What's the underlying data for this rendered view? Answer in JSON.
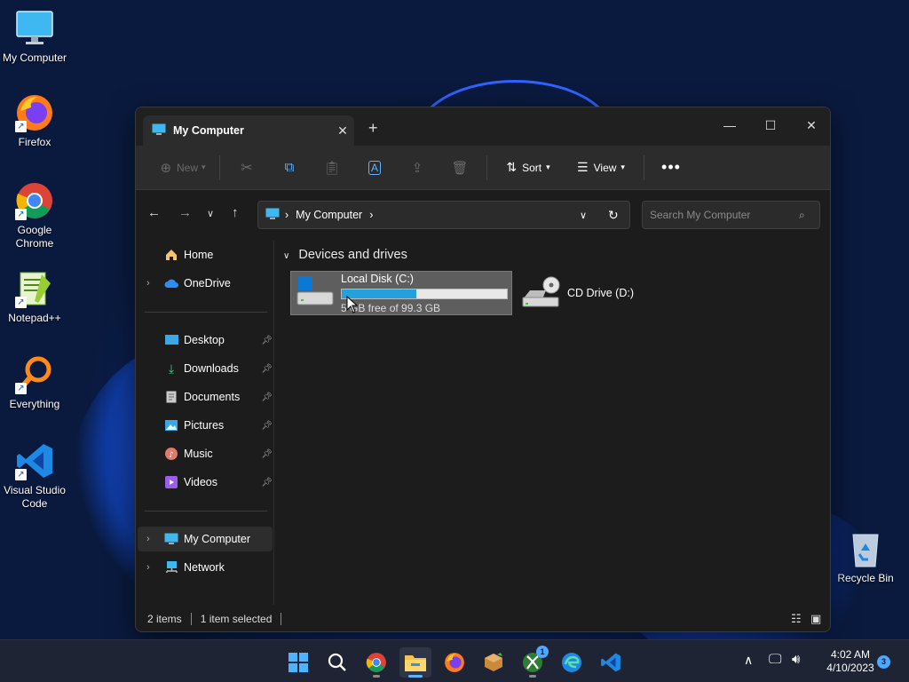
{
  "desktop": {
    "icons": [
      {
        "label": "My Computer"
      },
      {
        "label": "Firefox"
      },
      {
        "label": "Google Chrome"
      },
      {
        "label": "Notepad++"
      },
      {
        "label": "Everything"
      },
      {
        "label": "Visual Studio Code"
      },
      {
        "label": "Recycle Bin"
      }
    ]
  },
  "window": {
    "tab_title": "My Computer",
    "toolbar": {
      "new_label": "New",
      "sort_label": "Sort",
      "view_label": "View"
    },
    "address": {
      "segment": "My Computer"
    },
    "search": {
      "placeholder": "Search My Computer"
    },
    "sidebar": {
      "items": [
        {
          "label": "Home"
        },
        {
          "label": "OneDrive"
        },
        {
          "label": "Desktop"
        },
        {
          "label": "Downloads"
        },
        {
          "label": "Documents"
        },
        {
          "label": "Pictures"
        },
        {
          "label": "Music"
        },
        {
          "label": "Videos"
        },
        {
          "label": "My Computer"
        },
        {
          "label": "Network"
        }
      ]
    },
    "content": {
      "group_label": "Devices and drives",
      "drives": [
        {
          "name": "Local Disk (C:)",
          "free_text": "5 GB free of 99.3 GB",
          "used_fraction": 0.45
        },
        {
          "name": "CD Drive (D:)"
        }
      ]
    },
    "status": {
      "items_count": "2 items",
      "selected": "1 item selected"
    }
  },
  "taskbar": {
    "xbox_badge": "1",
    "time": "4:02 AM",
    "date": "4/10/2023",
    "notification_count": "3"
  },
  "colors": {
    "accent": "#26a0da",
    "window_bg": "#1c1c1c",
    "taskbar_bg": "#1e2433"
  }
}
